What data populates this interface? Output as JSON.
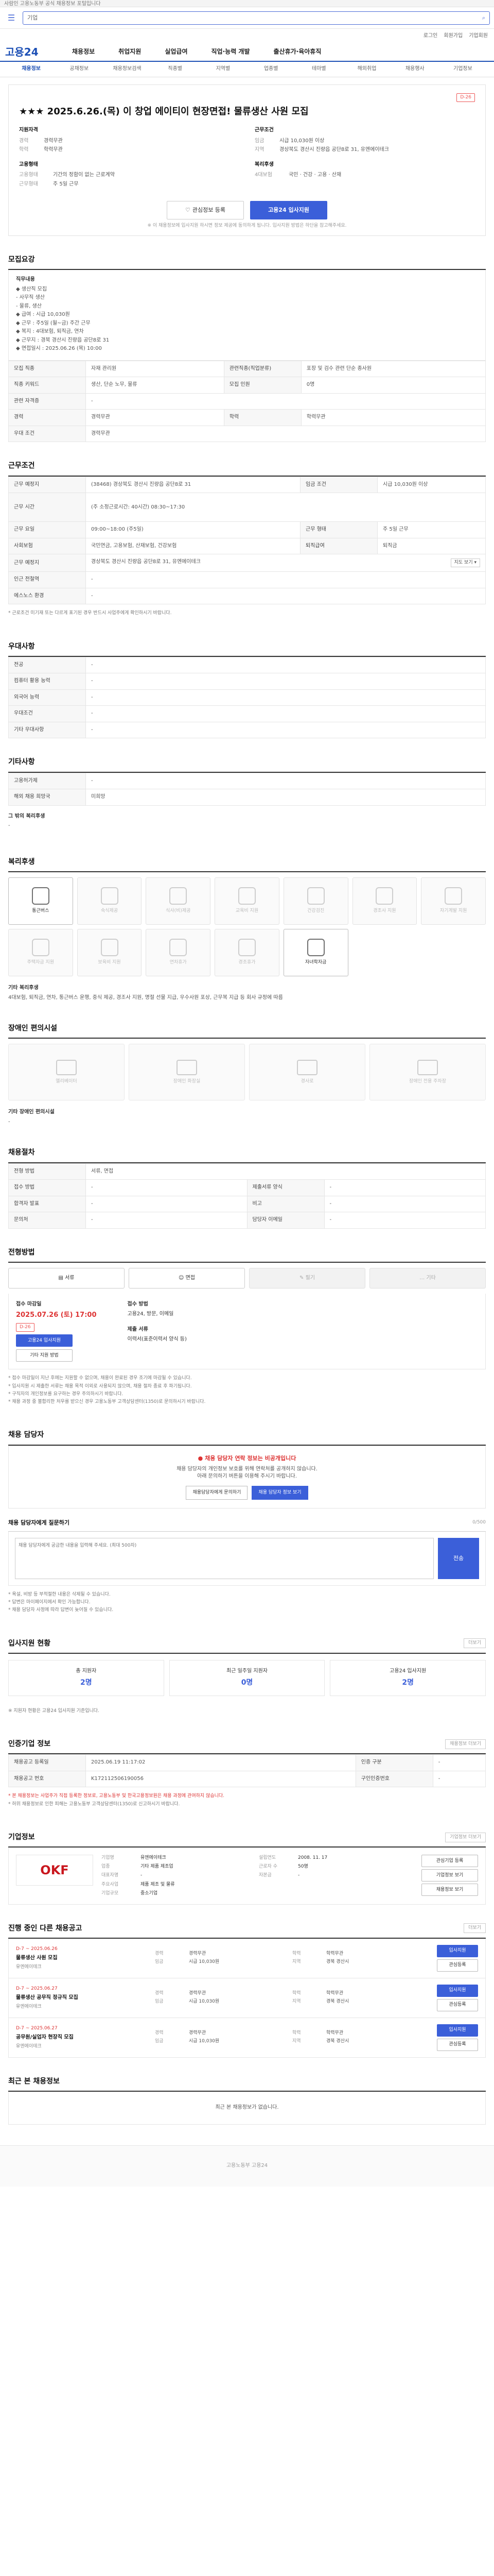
{
  "topbar": {
    "text": "사람인 고용노동부 공식 채용정보 포털입니다"
  },
  "search": {
    "placeholder": "기업",
    "menu": "≡"
  },
  "gnb": {
    "items": [
      "로그인",
      "회원가입",
      "기업회원"
    ]
  },
  "brand": {
    "logo": "고용24"
  },
  "nav": {
    "items": [
      "채용정보",
      "취업지원",
      "실업급여",
      "직업·능력 개발",
      "출산휴가·육아휴직"
    ]
  },
  "subnav": {
    "items": [
      "채용정보",
      "공채정보",
      "채용정보검색",
      "직종별",
      "지역별",
      "업종별",
      "테마별",
      "해외취업",
      "채용행사",
      "기업정보"
    ],
    "active": 0
  },
  "job": {
    "badge": "D-26",
    "title": "★★★ 2025.6.26.(목) 이 창업 에이티이 현장면접! 물류생산 사원 모집",
    "left_title": "지원자격",
    "left": [
      {
        "k": "경력",
        "v": "경력무관"
      },
      {
        "k": "학력",
        "v": "학력무관"
      }
    ],
    "left2_title": "고용형태",
    "left2": [
      {
        "k": "고용형태",
        "v": "기간의 정함이 없는 근로계약"
      },
      {
        "k": "근무형태",
        "v": "주 5일 근무"
      }
    ],
    "right_title": "근무조건",
    "right": [
      {
        "k": "임금",
        "v": "시급 10,030원 이상"
      },
      {
        "k": "지역",
        "v": "경상북도 경산시 진량읍 공단8로 31, 유엔에이테크"
      }
    ],
    "right2_title": "복리후생",
    "right2": [
      {
        "k": "4대보험",
        "v": "국민 · 건강 · 고용 · 산재"
      }
    ]
  },
  "cta": {
    "scrap": "관심정보 등록",
    "apply": "고용24 입사지원",
    "note": "※ 이 채용정보에 입사지원 하시면 정보 제공에 동의하게 됩니다. 입사지원 방법은 하단을 참고해주세요."
  },
  "sec_recruit": {
    "title": "모집요강",
    "right": "",
    "duty_title": "직무내용",
    "duty": [
      "◆ 생산직 모집",
      "- 사무직 생산",
      "- 물류, 생산",
      "",
      "◆ 급여 : 시급 10,030원",
      "◆ 근무 : 주5일 (월~금) 주간 근무",
      "◆ 복지 : 4대보험, 퇴직금, 연차",
      "◆ 근무지 : 경북 경산시 진량읍 공단8로 31",
      "◆ 면접일시 : 2025.06.26 (목) 10:00"
    ],
    "rows": [
      {
        "k": "모집 직종",
        "v": "자재 관리원",
        "k2": "관련직종(직업분류)",
        "v2": "포장 및 검수 관련 단순 종사원"
      },
      {
        "k": "직종 키워드",
        "v": "생산, 단순 노무, 물류",
        "k2": "모집 인원",
        "v2": "0명"
      },
      {
        "k": "관련 자격증",
        "v": "-",
        "k2": "",
        "v2": ""
      },
      {
        "k": "경력",
        "v": "경력무관",
        "k2": "학력",
        "v2": "학력무관"
      },
      {
        "k": "우대 조건",
        "v": "경력무관",
        "k2": "",
        "v2": ""
      }
    ]
  },
  "sec_conditions": {
    "title": "근무조건",
    "rows": [
      {
        "k": "근무 예정지",
        "v": "(38468) 경상북도 경산시 진량읍 공단8로 31",
        "k2": "임금 조건",
        "v2": "시급 10,030원 이상"
      },
      {
        "k": "근무 시간",
        "v": "(주 소정근로시간: 40시간) 08:30~17:30",
        "k2": "",
        "v2": ""
      },
      {
        "k": "근무 요일",
        "v": "09:00~18:00 (주5일)",
        "k2": "근무 형태",
        "v2": "주 5일 근무"
      },
      {
        "k": "사회보험",
        "v": "국민연금, 고용보험, 산재보험, 건강보험",
        "k2": "퇴직급여",
        "v2": "퇴직금"
      },
      {
        "k": "근무 예정지",
        "v": "경상북도 경산시 진량읍 공단8로 31, 유엔에이테크",
        "k2": "",
        "v2": ""
      },
      {
        "k": "인근 전철역",
        "v": "-",
        "k2": "",
        "v2": ""
      },
      {
        "k": "에스노스 환경",
        "v": "-",
        "k2": "",
        "v2": ""
      }
    ],
    "note": "* 근로조건 미기재 또는 다르게 표기된 경우 반드시 사업주에게 확인하시기 바랍니다."
  },
  "sec_pref": {
    "title": "우대사항",
    "rows": [
      {
        "k": "전공",
        "v": "-"
      },
      {
        "k": "컴퓨터 활용 능력",
        "v": "-"
      },
      {
        "k": "외국어 능력",
        "v": "-"
      },
      {
        "k": "우대조건",
        "v": "-"
      },
      {
        "k": "기타 우대사항",
        "v": "-"
      }
    ]
  },
  "sec_etc": {
    "title": "기타사항",
    "rows": [
      {
        "k": "고용허가제",
        "v": "-"
      },
      {
        "k": "해외 채용 희망국",
        "v": "미희망"
      }
    ],
    "extra_title": "그 밖의 복리후생",
    "extra": "-"
  },
  "sec_welfare": {
    "title": "복리후생",
    "items": [
      {
        "label": "통근버스",
        "on": true
      },
      {
        "label": "숙식제공",
        "on": false
      },
      {
        "label": "식사(비)제공",
        "on": false
      },
      {
        "label": "교육비 지원",
        "on": false
      },
      {
        "label": "건강검진",
        "on": false
      },
      {
        "label": "경조사 지원",
        "on": false
      },
      {
        "label": "자기계발 지원",
        "on": false
      },
      {
        "label": "주택자금 지원",
        "on": false
      },
      {
        "label": "보육비 지원",
        "on": false
      },
      {
        "label": "연차휴가",
        "on": false
      },
      {
        "label": "경조휴가",
        "on": false
      },
      {
        "label": "자녀학자금",
        "on": true
      }
    ],
    "note_title": "기타 복리후생",
    "note": "4대보험, 퇴직금, 연차, 통근버스 운행, 중식 제공, 경조사 지원, 명절 선물 지급, 우수사원 포상, 근무복 지급 등 회사 규정에 따름"
  },
  "sec_facility": {
    "title": "장애인 편의시설",
    "items": [
      "엘리베이터",
      "장애인 화장실",
      "경사로",
      "장애인 전용 주차장"
    ],
    "note_title": "기타 장애인 편의시설",
    "note": "-"
  },
  "sec_process": {
    "title": "채용절차",
    "rows": [
      {
        "k": "전형 방법",
        "v": "서류, 면접",
        "k2": "",
        "v2": ""
      },
      {
        "k": "접수 방법",
        "v": "-",
        "k2": "제출서류 양식",
        "v2": "-"
      },
      {
        "k": "합격자 발표",
        "v": "-",
        "k2": "비고",
        "v2": "-"
      },
      {
        "k": "문의처",
        "v": "-",
        "k2": "담당자 이메일",
        "v2": "-"
      }
    ]
  },
  "sec_method": {
    "title": "전형방법",
    "items": [
      {
        "label": "서류",
        "on": true
      },
      {
        "label": "면접",
        "on": true
      },
      {
        "label": "필기",
        "on": false
      },
      {
        "label": "기타",
        "on": false
      }
    ]
  },
  "sec_apply": {
    "title": "접수 마감일",
    "deadline": "2025.07.26 (토) 17:00",
    "dday": "D-26",
    "apply_btn": "고용24 입사지원",
    "etc_btn": "기타 지원 방법",
    "method_title": "접수 방법",
    "method": "고용24, 방문, 이메일",
    "doc_title": "제출 서류",
    "doc": "이력서(표준이력서 양식 등)",
    "notes": [
      "* 접수 마감일이 지난 후에는 지원할 수 없으며, 채용이 완료된 경우 조기에 마감될 수 있습니다.",
      "* 입사지원 시 제출한 서류는 채용 목적 이외로 사용되지 않으며, 채용 절차 종료 후 파기됩니다.",
      "* 구직자의 개인정보를 요구하는 경우 주의하시기 바랍니다.",
      "* 채용 과정 중 불합리한 처우를 받으신 경우 고용노동부 고객상담센터(1350)로 문의하시기 바랍니다."
    ]
  },
  "sec_contact": {
    "title": "채용 담당자",
    "warn": "채용 담당자 연락 정보는 비공개입니다",
    "desc": "채용 담당자의 개인정보 보호를 위해 연락처를 공개하지 않습니다.",
    "desc2": "아래 문의하기 버튼을 이용해 주시기 바랍니다.",
    "btn1": "채용담당자에게 문의하기",
    "btn2": "채용 담당자 정보 보기"
  },
  "sec_inquiry": {
    "title": "채용 담당자에게 질문하기",
    "placeholder": "채용 담당자에게 궁금한 내용을 입력해 주세요. (최대 500자)",
    "send": "전송",
    "notes": [
      "* 욕설, 비방 등 부적절한 내용은 삭제될 수 있습니다.",
      "* 답변은 마이페이지에서 확인 가능합니다.",
      "* 채용 담당자 사정에 따라 답변이 늦어질 수 있습니다."
    ]
  },
  "sec_stats": {
    "title": "입사지원 현황",
    "more": "더보기",
    "items": [
      {
        "label": "총 지원자",
        "value": "2명"
      },
      {
        "label": "최근 일주일 지원자",
        "value": "0명"
      },
      {
        "label": "고용24 입사지원",
        "value": "2명"
      }
    ],
    "note": "※ 지원자 현황은 고용24 입사지원 기준입니다."
  },
  "sec_info": {
    "title": "인증기업 정보",
    "more": "채용정보 더보기",
    "rows": [
      {
        "k": "채용공고 등록일",
        "v": "2025.06.19 11:17:02",
        "k2": "인증 구분",
        "v2": "-"
      },
      {
        "k": "채용공고 번호",
        "v": "K172112506190056",
        "k2": "구인인증번호",
        "v2": "-"
      }
    ],
    "notes": [
      "* 본 채용정보는 사업주가 직접 등록한 정보로, 고용노동부 및 한국고용정보원은 채용 과정에 관여하지 않습니다.",
      "* 허위 채용정보로 인한 피해는 고용노동부 고객상담센터(1350)로 신고하시기 바랍니다."
    ]
  },
  "sec_corp": {
    "title": "기업정보",
    "more": "기업정보 더보기",
    "logo": "OKF",
    "rows": [
      {
        "k": "기업명",
        "v": "유엔에이테크",
        "k2": "설립연도",
        "v2": "2008. 11. 17"
      },
      {
        "k": "업종",
        "v": "기타 제품 제조업",
        "k2": "근로자 수",
        "v2": "50명"
      },
      {
        "k": "대표자명",
        "v": "-",
        "k2": "자본금",
        "v2": "-"
      },
      {
        "k": "주요사업",
        "v": "제품 제조 및 물류",
        "k2": "",
        "v2": ""
      },
      {
        "k": "기업규모",
        "v": "중소기업",
        "k2": "",
        "v2": ""
      }
    ],
    "btns": [
      "관심기업 등록",
      "기업정보 보기",
      "채용정보 보기"
    ]
  },
  "sec_other": {
    "title": "진행 중인 다른 채용공고",
    "more": "더보기",
    "items": [
      {
        "dday": "D-7 ~ 2025.06.26",
        "title": "물류생산 사원 모집",
        "company": "유엔에이테크",
        "k1": "경력",
        "v1": "경력무관",
        "k2": "학력",
        "v2": "학력무관",
        "k3": "임금",
        "v3": "시급 10,030원",
        "k4": "지역",
        "v4": "경북 경산시",
        "btn1": "입사지원",
        "btn2": "관심등록"
      },
      {
        "dday": "D-7 ~ 2025.06.27",
        "title": "물류생산 공무직 정규직 모집",
        "company": "유엔에이테크",
        "k1": "경력",
        "v1": "경력무관",
        "k2": "학력",
        "v2": "학력무관",
        "k3": "임금",
        "v3": "시급 10,030원",
        "k4": "지역",
        "v4": "경북 경산시",
        "btn1": "입사지원",
        "btn2": "관심등록"
      },
      {
        "dday": "D-7 ~ 2025.06.27",
        "title": "공무원/실업자 현장직 모집",
        "company": "유엔에이테크",
        "k1": "경력",
        "v1": "경력무관",
        "k2": "학력",
        "v2": "학력무관",
        "k3": "임금",
        "v3": "시급 10,030원",
        "k4": "지역",
        "v4": "경북 경산시",
        "btn1": "입사지원",
        "btn2": "관심등록"
      }
    ]
  },
  "sec_recent": {
    "title": "최근 본 채용정보",
    "empty": "최근 본 채용정보가 없습니다."
  },
  "footer": {
    "text": "고용노동부 고용24"
  }
}
